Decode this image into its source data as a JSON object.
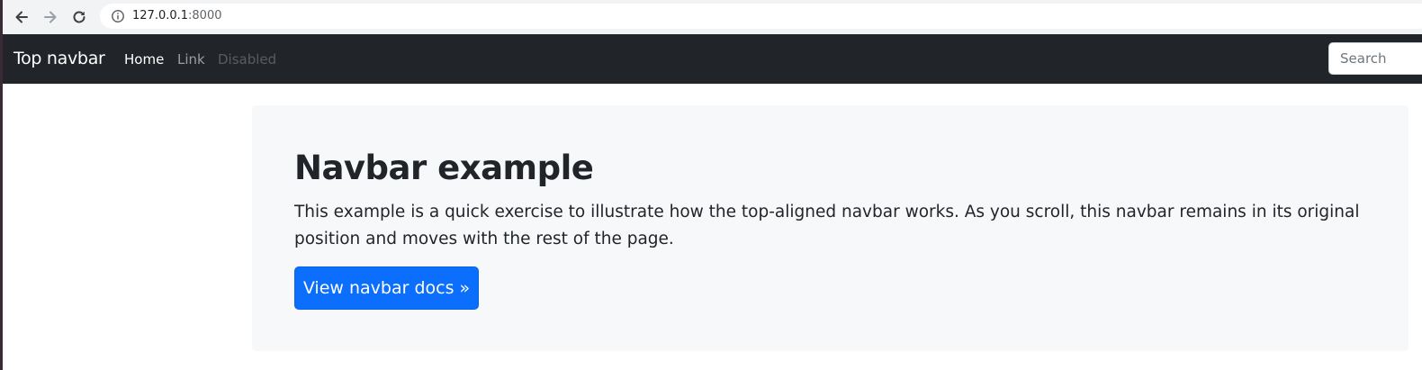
{
  "browser": {
    "url_host": "127.0.0.1",
    "url_port": ":8000"
  },
  "navbar": {
    "brand": "Top navbar",
    "links": [
      {
        "label": "Home",
        "state": "active"
      },
      {
        "label": "Link",
        "state": "normal"
      },
      {
        "label": "Disabled",
        "state": "disabled"
      }
    ],
    "search_placeholder": "Search",
    "background_color": "#212529"
  },
  "jumbotron": {
    "title": "Navbar example",
    "lead": "This example is a quick exercise to illustrate how the top-aligned navbar works. As you scroll, this navbar remains in its original position and moves with the rest of the page.",
    "button_label": "View navbar docs »",
    "button_color": "#0b6efd"
  }
}
